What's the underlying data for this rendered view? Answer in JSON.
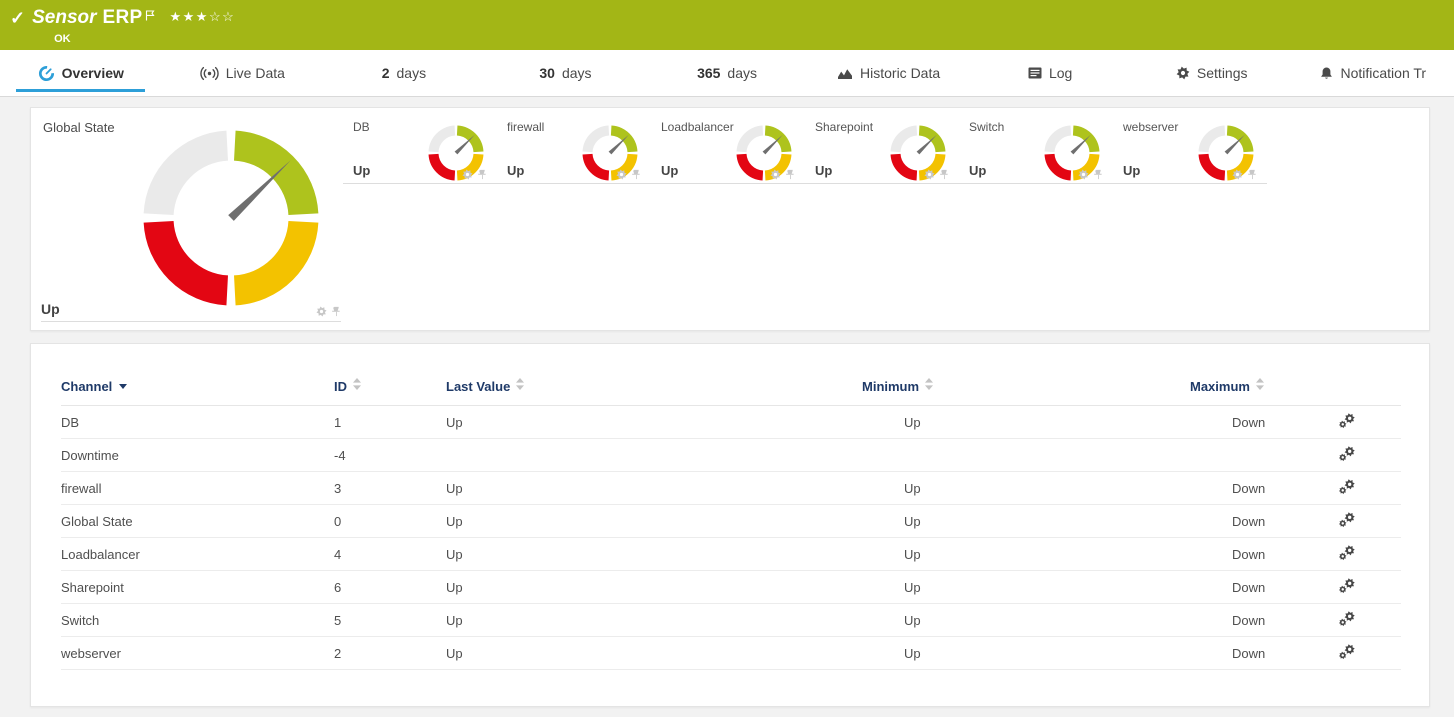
{
  "colors": {
    "header_bg": "#a3b616",
    "accent_blue": "#2d9fd8",
    "gauge_green": "#aec31d",
    "gauge_yellow": "#f3c200",
    "gauge_red": "#e30613",
    "gauge_gray": "#eaeaea",
    "needle": "#6f6f6f",
    "table_header_text": "#1f3a68",
    "page_bg": "#f2f2f2",
    "panel_bg": "#ffffff",
    "icon_gray": "#c7c7c7",
    "icon_dark": "#474747"
  },
  "header": {
    "check_icon": "✓",
    "title_prefix": "Sensor",
    "title": "ERP",
    "status": "OK",
    "stars_filled": 3,
    "stars_total": 5
  },
  "tabs": [
    {
      "label": "Overview",
      "icon": "gauge",
      "active": true
    },
    {
      "label": "Live Data",
      "icon": "broadcast"
    },
    {
      "prefix": "2",
      "label": "days"
    },
    {
      "prefix": "30",
      "label": "days"
    },
    {
      "prefix": "365",
      "label": "days"
    },
    {
      "label": "Historic Data",
      "icon": "chart"
    },
    {
      "label": "Log",
      "icon": "log"
    },
    {
      "label": "Settings",
      "icon": "gear"
    },
    {
      "label": "Notification Tr",
      "icon": "bell"
    }
  ],
  "global_gauge": {
    "title": "Global State",
    "value": "Up"
  },
  "channel_gauges": [
    {
      "title": "DB",
      "value": "Up"
    },
    {
      "title": "firewall",
      "value": "Up"
    },
    {
      "title": "Loadbalancer",
      "value": "Up"
    },
    {
      "title": "Sharepoint",
      "value": "Up"
    },
    {
      "title": "Switch",
      "value": "Up"
    },
    {
      "title": "webserver",
      "value": "Up"
    }
  ],
  "table": {
    "columns": [
      {
        "label": "Channel",
        "sort": "desc"
      },
      {
        "label": "ID",
        "sort": "none"
      },
      {
        "label": "Last Value",
        "sort": "none"
      },
      {
        "label": "Minimum",
        "sort": "none"
      },
      {
        "label": "Maximum",
        "sort": "none"
      }
    ],
    "rows": [
      {
        "channel": "DB",
        "id": "1",
        "last_value": "Up",
        "minimum": "Up",
        "maximum": "Down"
      },
      {
        "channel": "Downtime",
        "id": "-4",
        "last_value": "",
        "minimum": "",
        "maximum": ""
      },
      {
        "channel": "firewall",
        "id": "3",
        "last_value": "Up",
        "minimum": "Up",
        "maximum": "Down"
      },
      {
        "channel": "Global State",
        "id": "0",
        "last_value": "Up",
        "minimum": "Up",
        "maximum": "Down"
      },
      {
        "channel": "Loadbalancer",
        "id": "4",
        "last_value": "Up",
        "minimum": "Up",
        "maximum": "Down"
      },
      {
        "channel": "Sharepoint",
        "id": "6",
        "last_value": "Up",
        "minimum": "Up",
        "maximum": "Down"
      },
      {
        "channel": "Switch",
        "id": "5",
        "last_value": "Up",
        "minimum": "Up",
        "maximum": "Down"
      },
      {
        "channel": "webserver",
        "id": "2",
        "last_value": "Up",
        "minimum": "Up",
        "maximum": "Down"
      }
    ]
  }
}
